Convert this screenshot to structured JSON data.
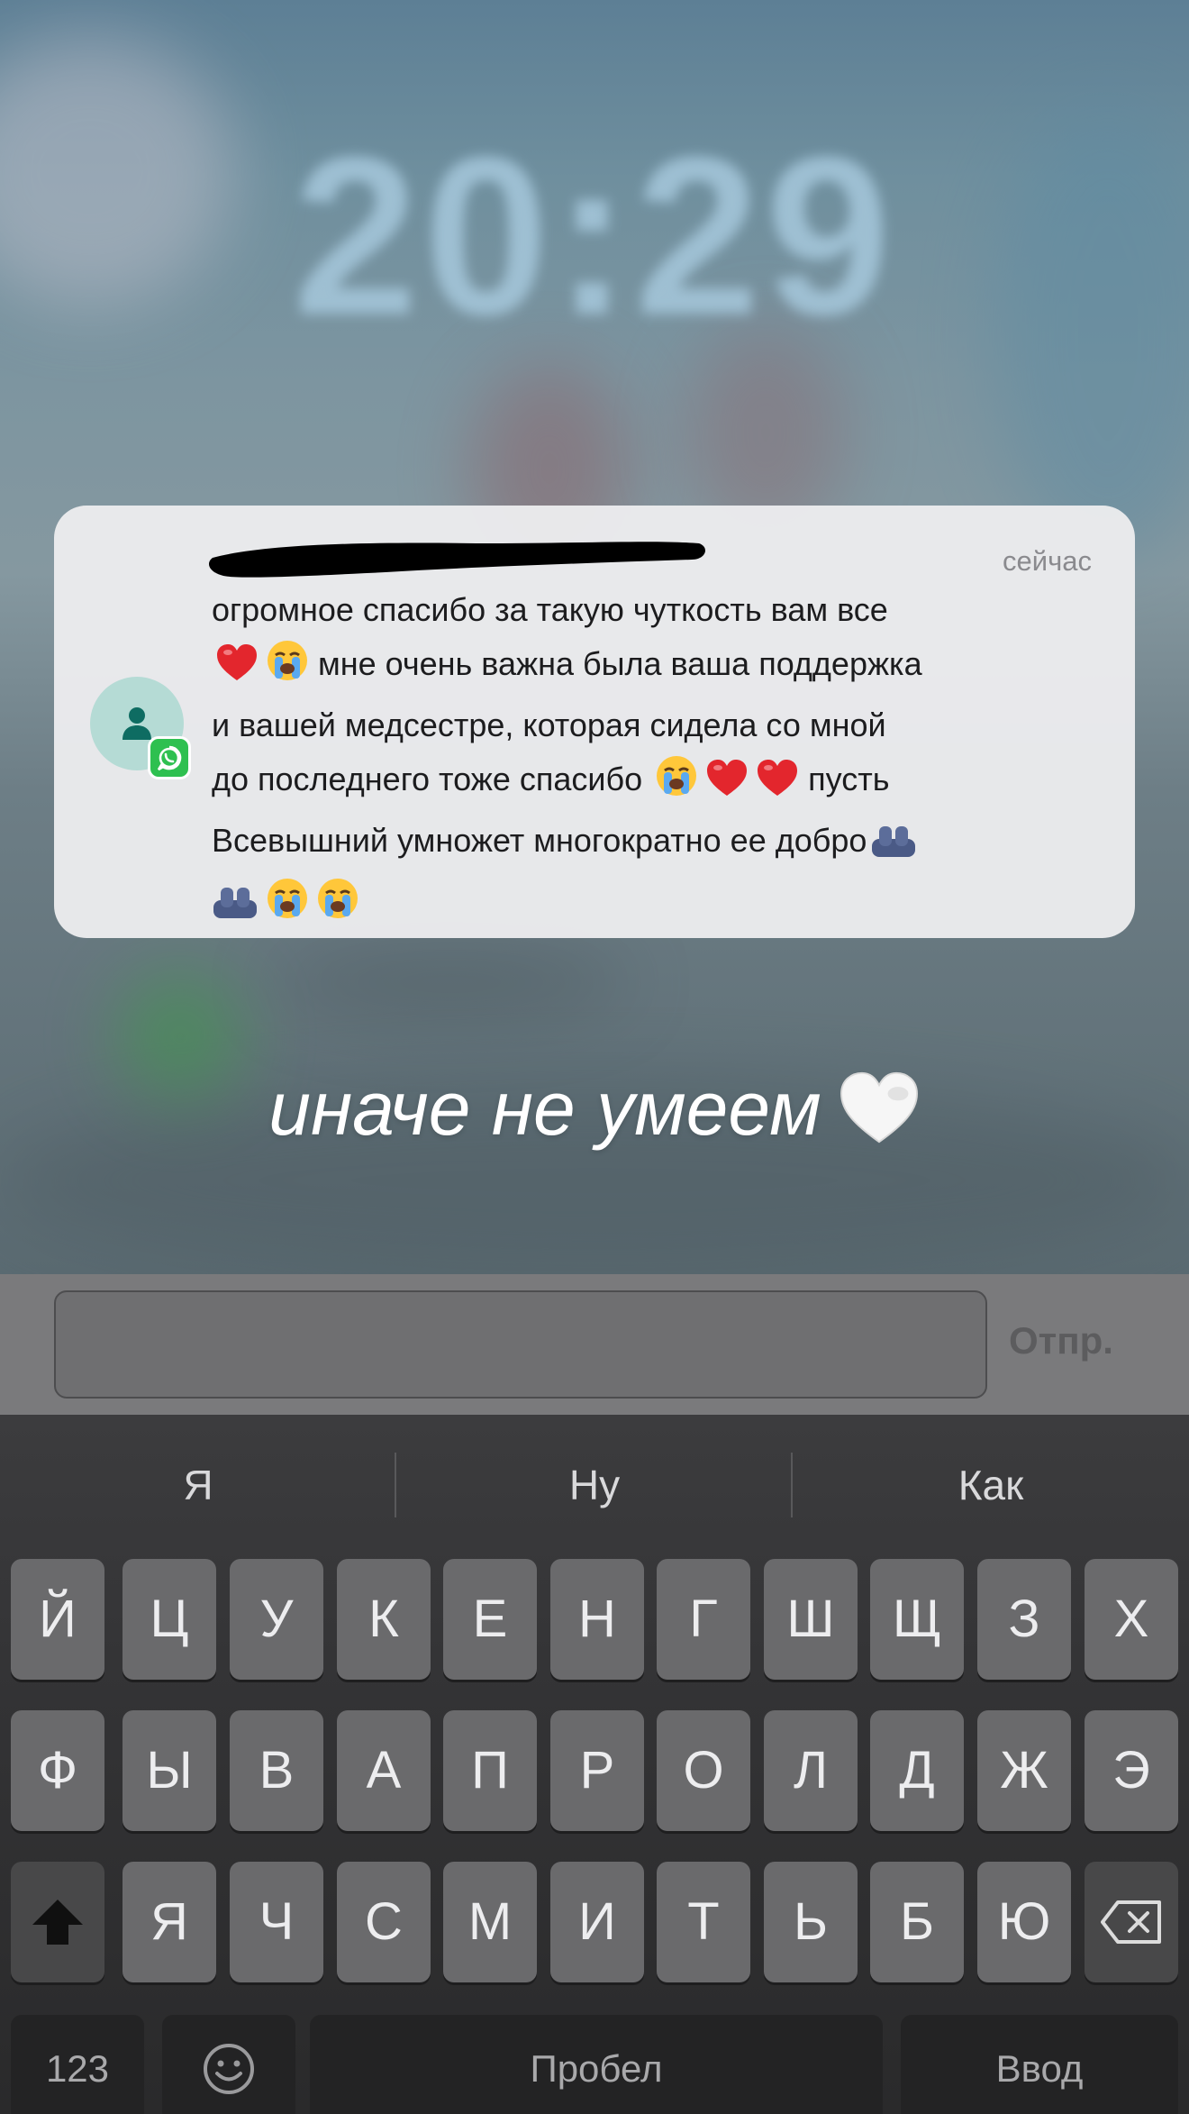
{
  "lock_screen": {
    "clock_time": "20:29"
  },
  "notification": {
    "app_icon": "whatsapp-icon",
    "avatar_icon": "person-icon",
    "time": "сейчас",
    "message": {
      "seg1": "огромное спасибо за такую чуткость вам все",
      "seg2": "мне очень важна была ваша поддержка",
      "seg3": "и вашей медсестре, которая сидела со мной",
      "seg4": "до последнего тоже спасибо",
      "seg5": "пусть",
      "seg6": "Всевышний умножет многократно ее добро"
    },
    "emoji_colors": {
      "heart": "#e3262d",
      "crying_face": "#ffc73a",
      "tears": "#5aa9f0",
      "hands": "#4a5a86"
    }
  },
  "caption": {
    "text": "иначе не умеем",
    "emoji": "white-heart"
  },
  "input_bar": {
    "text_value": "",
    "send_label": "Отпр."
  },
  "keyboard": {
    "suggestions": [
      "Я",
      "Ну",
      "Как"
    ],
    "row1": [
      "Й",
      "Ц",
      "У",
      "К",
      "Е",
      "Н",
      "Г",
      "Ш",
      "Щ",
      "З",
      "Х"
    ],
    "row2": [
      "Ф",
      "Ы",
      "В",
      "А",
      "П",
      "Р",
      "О",
      "Л",
      "Д",
      "Ж",
      "Э"
    ],
    "row3": [
      "Я",
      "Ч",
      "С",
      "М",
      "И",
      "Т",
      "Ь",
      "Б",
      "Ю"
    ],
    "numbers_label": "123",
    "space_label": "Пробел",
    "return_label": "Ввод",
    "shift_icon": "shift-icon",
    "delete_icon": "backspace-icon",
    "emoji_icon": "emoji-icon"
  }
}
